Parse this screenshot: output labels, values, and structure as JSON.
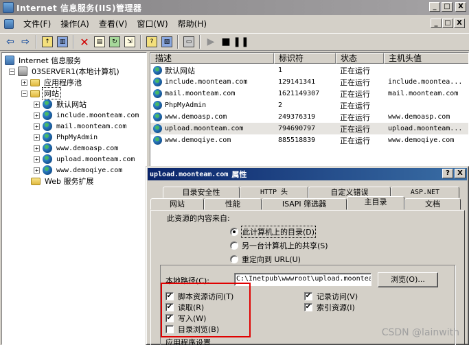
{
  "window": {
    "title": "Internet 信息服务(IIS)管理器",
    "buttons": {
      "minimize": "_",
      "maximize": "□",
      "close": "X"
    }
  },
  "menubar": {
    "items": [
      "文件(F)",
      "操作(A)",
      "查看(V)",
      "窗口(W)",
      "帮助(H)"
    ]
  },
  "tree": {
    "root": "Internet 信息服务",
    "server": "03SERVER1(本地计算机)",
    "app_pools": "应用程序池",
    "websites": "网站",
    "sites": [
      "默认网站",
      "include.moonteam.com",
      "mail.moonteam.com",
      "PhpMyAdmin",
      "www.demoasp.com",
      "upload.moonteam.com",
      "www.demoqiye.com"
    ],
    "web_ext": "Web 服务扩展"
  },
  "list": {
    "columns": [
      "描述",
      "标识符",
      "状态",
      "主机头值"
    ],
    "rows": [
      {
        "desc": "默认网站",
        "id": "1",
        "status": "正在运行",
        "host": ""
      },
      {
        "desc": "include.moonteam.com",
        "id": "129141341",
        "status": "正在运行",
        "host": "include.moontea..."
      },
      {
        "desc": "mail.moonteam.com",
        "id": "1621149307",
        "status": "正在运行",
        "host": "mail.moonteam.com"
      },
      {
        "desc": "PhpMyAdmin",
        "id": "2",
        "status": "正在运行",
        "host": ""
      },
      {
        "desc": "www.demoasp.com",
        "id": "249376319",
        "status": "正在运行",
        "host": "www.demoasp.com"
      },
      {
        "desc": "upload.moonteam.com",
        "id": "794690797",
        "status": "正在运行",
        "host": "upload.moonteam..."
      },
      {
        "desc": "www.demoqiye.com",
        "id": "885518839",
        "status": "正在运行",
        "host": "www.demoqiye.com"
      }
    ]
  },
  "dialog": {
    "title_site": "upload.moonteam.com",
    "title_suffix": "属性",
    "help": "?",
    "close": "X",
    "tabs_row1": [
      "目录安全性",
      "HTTP 头",
      "自定义错误",
      "ASP.NET"
    ],
    "tabs_row2": [
      "网站",
      "性能",
      "ISAPI 筛选器",
      "主目录",
      "文档"
    ],
    "source_label": "此资源的内容来自:",
    "radios": [
      "此计算机上的目录(D)",
      "另一台计算机上的共享(S)",
      "重定向到 URL(U)"
    ],
    "local_path_label": "本地路径(C):",
    "local_path_value": "C:\\Inetpub\\wwwroot\\upload.moonteam",
    "browse": "浏览(O)...",
    "checks_left": [
      {
        "label": "脚本资源访问(T)",
        "checked": true
      },
      {
        "label": "读取(R)",
        "checked": true
      },
      {
        "label": "写入(W)",
        "checked": true
      },
      {
        "label": "目录浏览(B)",
        "checked": false
      }
    ],
    "checks_right": [
      {
        "label": "记录访问(V)",
        "checked": true
      },
      {
        "label": "索引资源(I)",
        "checked": true
      }
    ],
    "app_settings": "应用程序设置"
  },
  "watermark": "CSDN @lainwith"
}
